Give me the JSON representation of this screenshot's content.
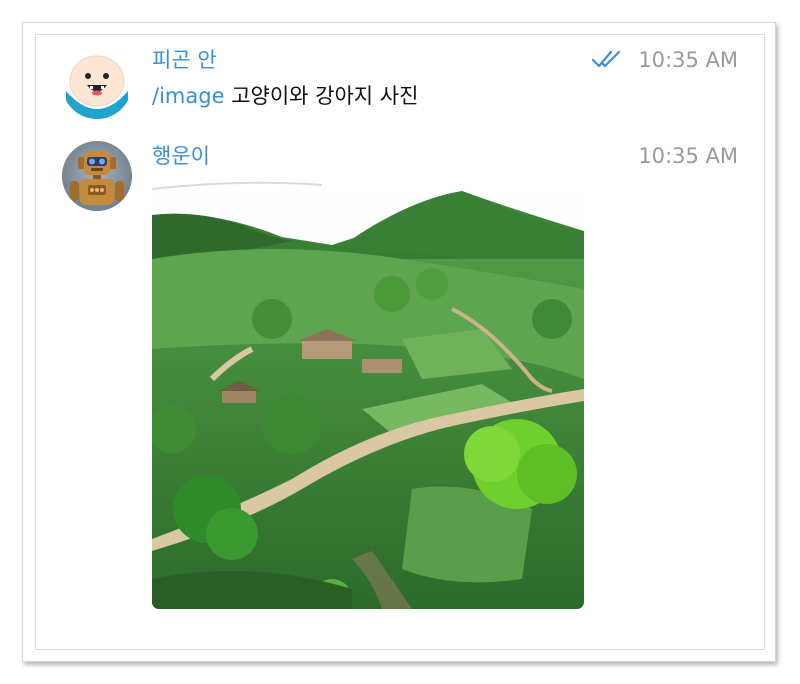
{
  "messages": [
    {
      "sender": "피곤 안",
      "time": "10:35 AM",
      "status_icon": "double-check-icon",
      "command": "/image",
      "text": "고양이와 강아지 사진",
      "avatar_icon": "cartoon-face-avatar"
    },
    {
      "sender": "행운이",
      "time": "10:35 AM",
      "avatar_icon": "robot-avatar",
      "image_subject": "aerial view of green hillside village with winding path"
    }
  ],
  "colors": {
    "accent": "#3a8fd0",
    "timestamp": "#9a9a9a",
    "text": "#111111"
  }
}
